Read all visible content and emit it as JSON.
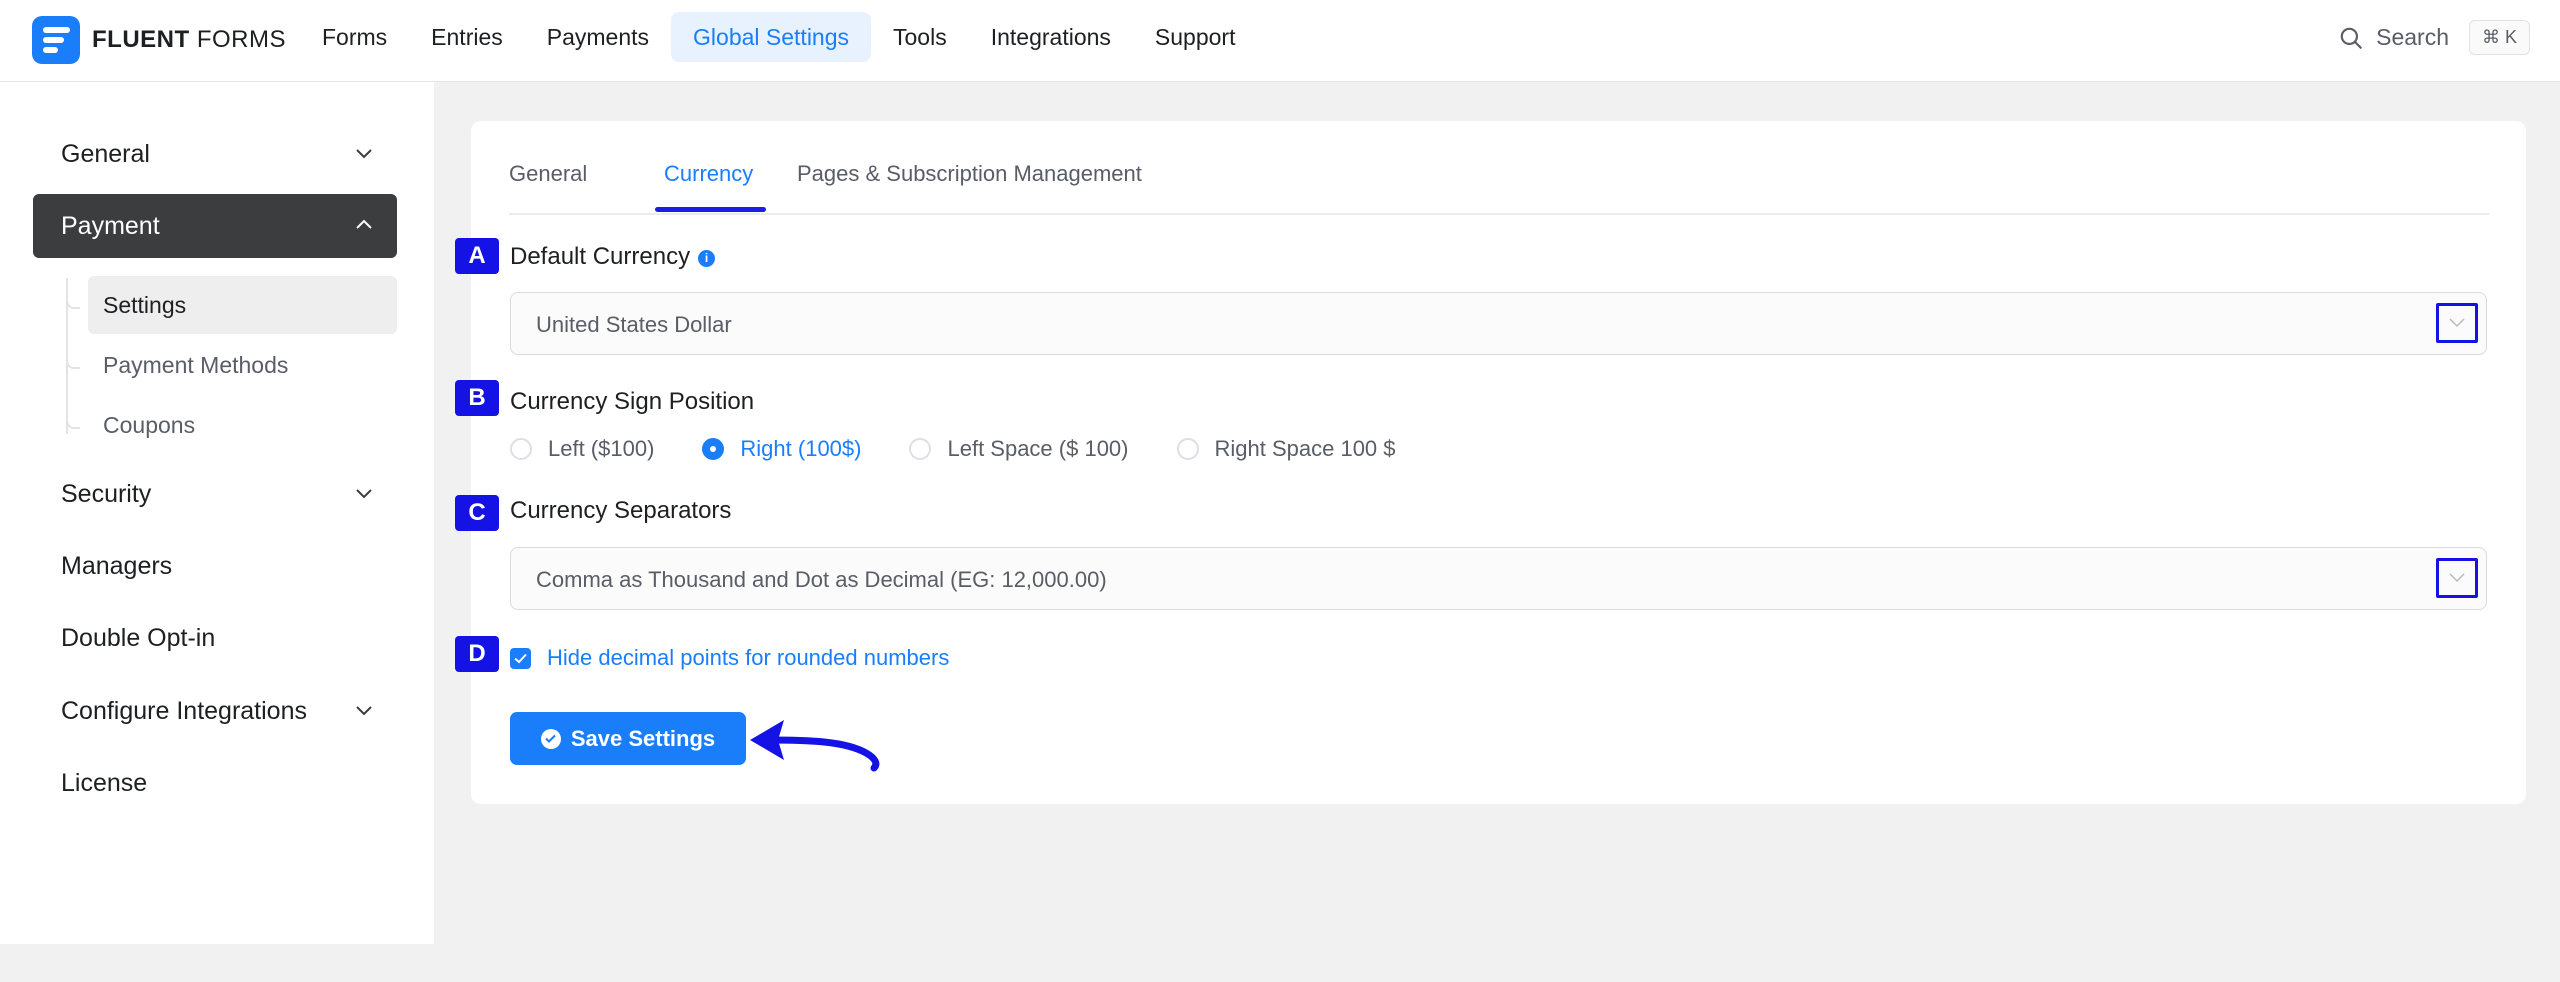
{
  "app": {
    "logo_bold": "FLUENT",
    "logo_light": " FORMS"
  },
  "nav": {
    "items": [
      "Forms",
      "Entries",
      "Payments",
      "Global Settings",
      "Tools",
      "Integrations",
      "Support"
    ],
    "active": "Global Settings"
  },
  "search": {
    "label": "Search",
    "shortcut": "⌘ K"
  },
  "sidebar": {
    "general": "General",
    "payment": "Payment",
    "payment_sub": [
      "Settings",
      "Payment Methods",
      "Coupons"
    ],
    "security": "Security",
    "managers": "Managers",
    "double_optin": "Double Opt-in",
    "configure_integrations": "Configure Integrations",
    "license": "License"
  },
  "tabs": {
    "general": "General",
    "currency": "Currency",
    "pages": "Pages & Subscription Management",
    "active": "Currency"
  },
  "badges": [
    "A",
    "B",
    "C",
    "D"
  ],
  "default_currency": {
    "label": "Default Currency",
    "info": "i",
    "value": "United States Dollar"
  },
  "sign_position": {
    "label": "Currency Sign Position",
    "options": [
      "Left ($100)",
      "Right (100$)",
      "Left Space ($ 100)",
      "Right Space 100 $"
    ],
    "selected": "Right (100$)"
  },
  "separators": {
    "label": "Currency Separators",
    "value": "Comma as Thousand and Dot as Decimal (EG: 12,000.00)"
  },
  "hide_decimal": {
    "label": "Hide decimal points for rounded numbers",
    "checked": true
  },
  "save": {
    "label": "Save Settings"
  },
  "colors": {
    "primary": "#1a7efb",
    "annotation": "#1512e6",
    "sidebar_active": "#3c3d3f"
  }
}
